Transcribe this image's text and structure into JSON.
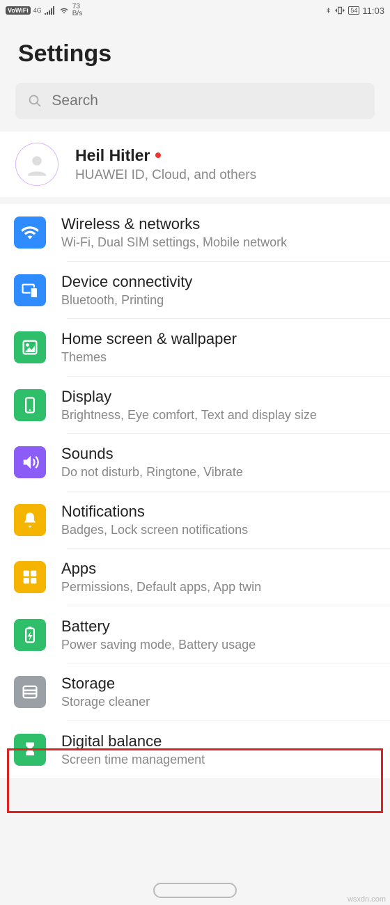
{
  "status": {
    "vowifi": "VoWiFi",
    "net": "4G",
    "speed_num": "73",
    "speed_unit": "B/s",
    "battery": "54",
    "time": "11:03"
  },
  "header": {
    "title": "Settings"
  },
  "search": {
    "placeholder": "Search"
  },
  "account": {
    "name": "Heil Hitler",
    "sub": "HUAWEI ID, Cloud, and others"
  },
  "rows": [
    {
      "icon": "wifi",
      "color": "#2f8cff",
      "title": "Wireless & networks",
      "sub": "Wi-Fi, Dual SIM settings, Mobile network"
    },
    {
      "icon": "device",
      "color": "#2f8cff",
      "title": "Device connectivity",
      "sub": "Bluetooth, Printing"
    },
    {
      "icon": "home",
      "color": "#2fbf6b",
      "title": "Home screen & wallpaper",
      "sub": "Themes"
    },
    {
      "icon": "display",
      "color": "#2fbf6b",
      "title": "Display",
      "sub": "Brightness, Eye comfort, Text and display size"
    },
    {
      "icon": "sound",
      "color": "#8b5cf6",
      "title": "Sounds",
      "sub": "Do not disturb, Ringtone, Vibrate"
    },
    {
      "icon": "bell",
      "color": "#f5b400",
      "title": "Notifications",
      "sub": "Badges, Lock screen notifications"
    },
    {
      "icon": "apps",
      "color": "#f5b400",
      "title": "Apps",
      "sub": "Permissions, Default apps, App twin"
    },
    {
      "icon": "battery",
      "color": "#2fbf6b",
      "title": "Battery",
      "sub": "Power saving mode, Battery usage"
    },
    {
      "icon": "storage",
      "color": "#9aa0a6",
      "title": "Storage",
      "sub": "Storage cleaner"
    },
    {
      "icon": "hourglass",
      "color": "#2fbf6b",
      "title": "Digital balance",
      "sub": "Screen time management"
    }
  ],
  "highlight_index": 6,
  "watermark": "wsxdn.com"
}
